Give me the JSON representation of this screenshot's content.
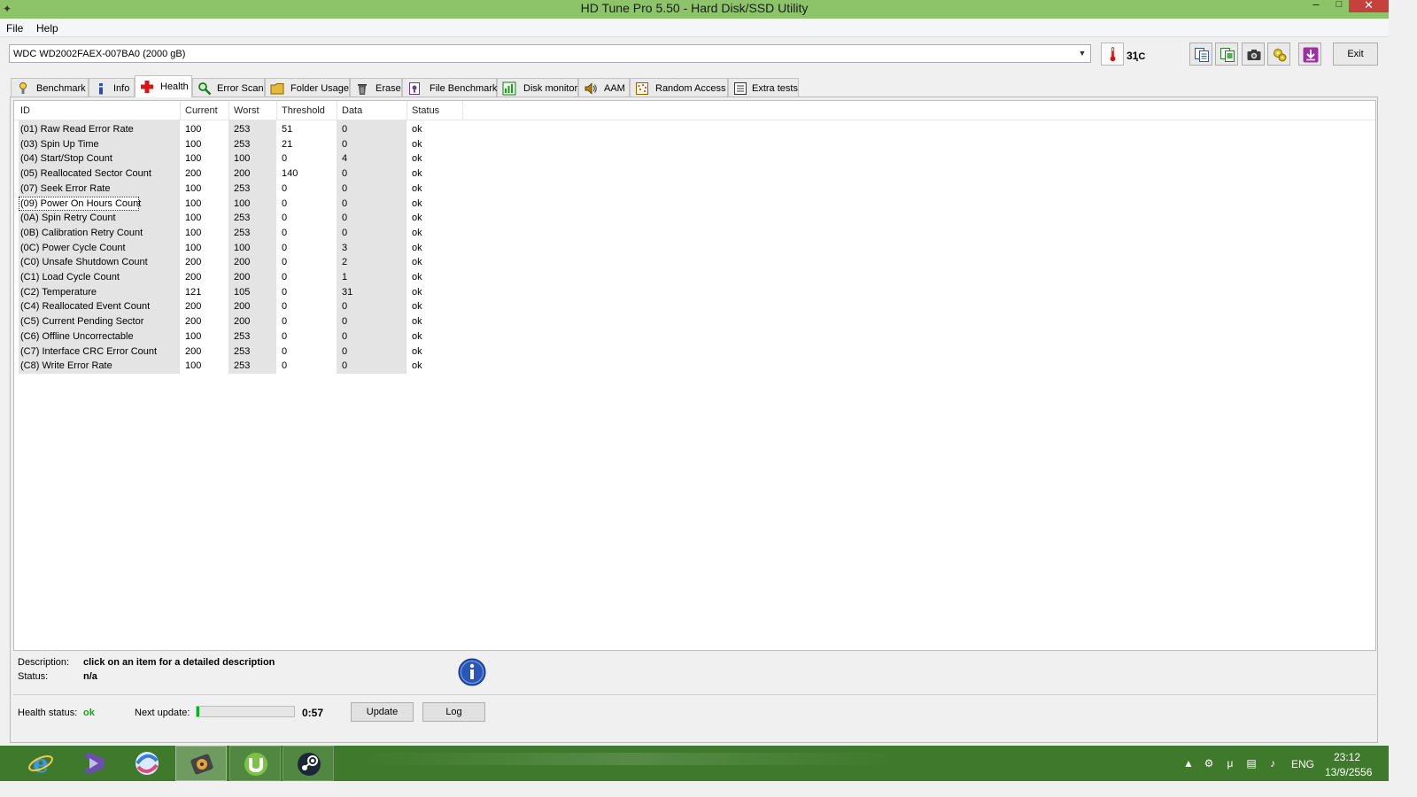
{
  "window": {
    "title": "HD Tune Pro 5.50 - Hard Disk/SSD Utility"
  },
  "menu": {
    "file": "File",
    "help": "Help"
  },
  "toolbar": {
    "drive": "WDC WD2002FAEX-007BA0 (2000 gB)",
    "temperature": "31",
    "temperature_unit": "ฺC",
    "exit_label": "Exit"
  },
  "tabs": [
    {
      "label": "Benchmark",
      "icon": "benchmark-icon"
    },
    {
      "label": "Info",
      "icon": "info-icon"
    },
    {
      "label": "Health",
      "icon": "health-cross-icon",
      "active": true
    },
    {
      "label": "Error Scan",
      "icon": "magnifier-icon"
    },
    {
      "label": "Folder Usage",
      "icon": "folder-icon"
    },
    {
      "label": "Erase",
      "icon": "trash-icon"
    },
    {
      "label": "File Benchmark",
      "icon": "file-benchmark-icon"
    },
    {
      "label": "Disk monitor",
      "icon": "disk-monitor-icon"
    },
    {
      "label": "AAM",
      "icon": "speaker-icon"
    },
    {
      "label": "Random Access",
      "icon": "random-access-icon"
    },
    {
      "label": "Extra tests",
      "icon": "extra-tests-icon"
    }
  ],
  "table": {
    "headers": [
      "ID",
      "Current",
      "Worst",
      "Threshold",
      "Data",
      "Status"
    ],
    "rows": [
      [
        "(01) Raw Read Error Rate",
        "100",
        "253",
        "51",
        "0",
        "ok"
      ],
      [
        "(03) Spin Up Time",
        "100",
        "253",
        "21",
        "0",
        "ok"
      ],
      [
        "(04) Start/Stop Count",
        "100",
        "100",
        "0",
        "4",
        "ok"
      ],
      [
        "(05) Reallocated Sector Count",
        "200",
        "200",
        "140",
        "0",
        "ok"
      ],
      [
        "(07) Seek Error Rate",
        "100",
        "253",
        "0",
        "0",
        "ok"
      ],
      [
        "(09) Power On Hours Count",
        "100",
        "100",
        "0",
        "0",
        "ok"
      ],
      [
        "(0A) Spin Retry Count",
        "100",
        "253",
        "0",
        "0",
        "ok"
      ],
      [
        "(0B) Calibration Retry Count",
        "100",
        "253",
        "0",
        "0",
        "ok"
      ],
      [
        "(0C) Power Cycle Count",
        "100",
        "100",
        "0",
        "3",
        "ok"
      ],
      [
        "(C0) Unsafe Shutdown Count",
        "200",
        "200",
        "0",
        "2",
        "ok"
      ],
      [
        "(C1) Load Cycle Count",
        "200",
        "200",
        "0",
        "1",
        "ok"
      ],
      [
        "(C2) Temperature",
        "121",
        "105",
        "0",
        "31",
        "ok"
      ],
      [
        "(C4) Reallocated Event Count",
        "200",
        "200",
        "0",
        "0",
        "ok"
      ],
      [
        "(C5) Current Pending Sector",
        "200",
        "200",
        "0",
        "0",
        "ok"
      ],
      [
        "(C6) Offline Uncorrectable",
        "100",
        "253",
        "0",
        "0",
        "ok"
      ],
      [
        "(C7) Interface CRC Error Count",
        "200",
        "253",
        "0",
        "0",
        "ok"
      ],
      [
        "(C8) Write Error Rate",
        "100",
        "253",
        "0",
        "0",
        "ok"
      ]
    ],
    "selected_row": 5
  },
  "description": {
    "desc_label": "Description:",
    "desc_value": "click on an item for a detailed description",
    "status_label": "Status:",
    "status_value": "n/a"
  },
  "health": {
    "label": "Health status:",
    "value": "ok",
    "next_update_label": "Next update:",
    "progress_fraction": 0.03,
    "countdown": "0:57",
    "update_button": "Update",
    "log_button": "Log"
  },
  "taskbar": {
    "apps": [
      "internet-explorer-icon",
      "visual-studio-icon",
      "browser-icon",
      "hd-tune-icon",
      "utorrent-icon",
      "steam-icon"
    ],
    "active_app": "hd-tune-icon",
    "language": "ENG",
    "time": "23:12",
    "date": "13/9/2556"
  },
  "colors": {
    "titlebar": "#8dc46a",
    "taskbar": "#3f7a2c",
    "health_ok": "#1aa31a",
    "progress_fill": "#06b025",
    "close_button": "#c7413c"
  }
}
